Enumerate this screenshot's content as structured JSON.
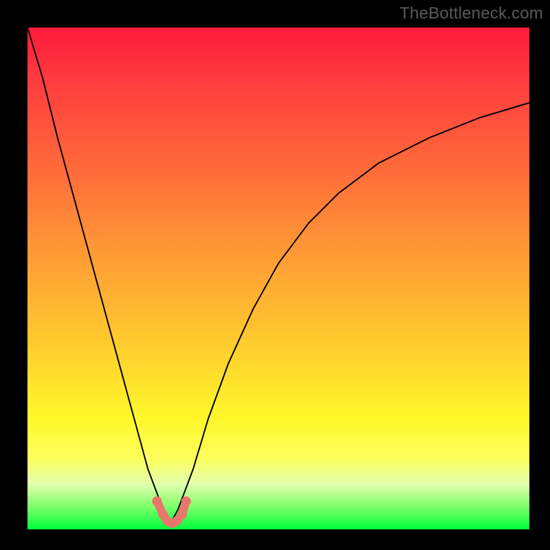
{
  "watermark": "TheBottleneck.com",
  "chart_data": {
    "type": "line",
    "title": "",
    "xlabel": "",
    "ylabel": "",
    "xlim": [
      0,
      100
    ],
    "ylim": [
      0,
      100
    ],
    "series": [
      {
        "name": "bottleneck-curve",
        "x": [
          0,
          3,
          6,
          9,
          12,
          15,
          18,
          21,
          24,
          27,
          28.5,
          30,
          33,
          36,
          40,
          45,
          50,
          56,
          62,
          70,
          80,
          90,
          100
        ],
        "y": [
          100,
          90,
          78,
          67,
          56,
          45,
          34,
          23,
          12,
          4,
          1.2,
          4,
          12,
          22,
          33,
          44,
          53,
          61,
          67,
          73,
          78,
          82,
          85
        ]
      }
    ],
    "markers": {
      "name": "optimal-range",
      "x": [
        25.8,
        27.0,
        27.8,
        28.8,
        29.8,
        30.8,
        31.6
      ],
      "y": [
        5.6,
        3.0,
        1.7,
        1.2,
        1.7,
        3.0,
        5.6
      ]
    },
    "gradient_stops": [
      {
        "pct": 0,
        "color": "#ff1a3c"
      },
      {
        "pct": 10,
        "color": "#ff3a3f"
      },
      {
        "pct": 28,
        "color": "#ff6a3a"
      },
      {
        "pct": 45,
        "color": "#ff9a35"
      },
      {
        "pct": 62,
        "color": "#ffc92e"
      },
      {
        "pct": 78,
        "color": "#fff82a"
      },
      {
        "pct": 86,
        "color": "#fdff5e"
      },
      {
        "pct": 91,
        "color": "#e3ffb0"
      },
      {
        "pct": 95,
        "color": "#8aff70"
      },
      {
        "pct": 100,
        "color": "#00ff3a"
      }
    ]
  }
}
